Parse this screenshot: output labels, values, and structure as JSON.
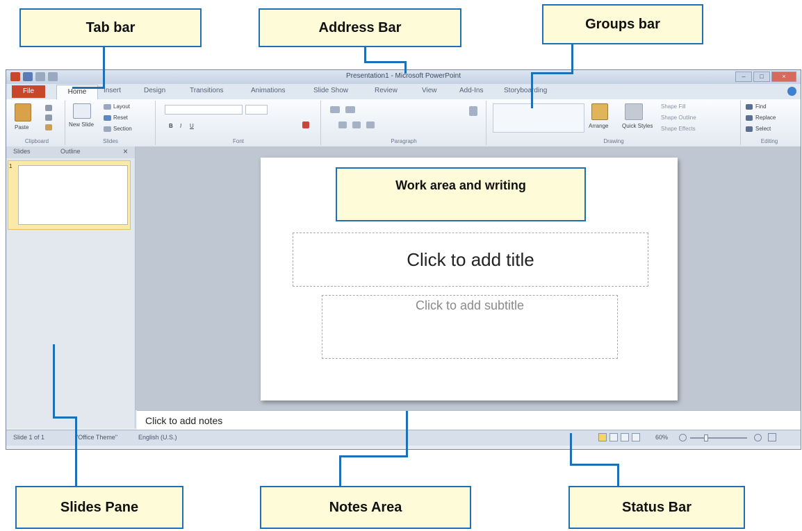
{
  "callouts": {
    "tab_bar": "Tab bar",
    "address_bar": "Address Bar",
    "groups_bar": "Groups bar",
    "work_area": "Work area and writing",
    "slides_pane": "Slides Pane",
    "notes_area": "Notes Area",
    "status_bar": "Status Bar"
  },
  "window": {
    "title": "Presentation1 - Microsoft PowerPoint",
    "file_tab": "File",
    "tabs": [
      "Home",
      "Insert",
      "Design",
      "Transitions",
      "Animations",
      "Slide Show",
      "Review",
      "View",
      "Add-Ins",
      "Storyboarding"
    ]
  },
  "ribbon": {
    "clipboard": {
      "paste": "Paste",
      "label": "Clipboard"
    },
    "slides": {
      "new_slide": "New Slide",
      "layout": "Layout",
      "reset": "Reset",
      "section": "Section",
      "label": "Slides"
    },
    "font": {
      "label": "Font"
    },
    "paragraph": {
      "label": "Paragraph"
    },
    "drawing": {
      "arrange": "Arrange",
      "quick_styles": "Quick Styles",
      "shape_fill": "Shape Fill",
      "shape_outline": "Shape Outline",
      "shape_effects": "Shape Effects",
      "label": "Drawing"
    },
    "editing": {
      "find": "Find",
      "replace": "Replace",
      "select": "Select",
      "label": "Editing"
    }
  },
  "slides_pane": {
    "tab_slides": "Slides",
    "tab_outline": "Outline",
    "close": "×",
    "slide_number": "1"
  },
  "slide": {
    "title_placeholder": "Click to add title",
    "subtitle_placeholder": "Click to add subtitle"
  },
  "notes": {
    "placeholder": "Click to add notes"
  },
  "status": {
    "slide_count": "Slide 1 of 1",
    "theme": "\"Office Theme\"",
    "language": "English (U.S.)",
    "zoom": "60%"
  },
  "colors": {
    "callout_fill": "#fdfbd8",
    "callout_border": "#1f6fb4",
    "file_tab": "#c8472c"
  }
}
